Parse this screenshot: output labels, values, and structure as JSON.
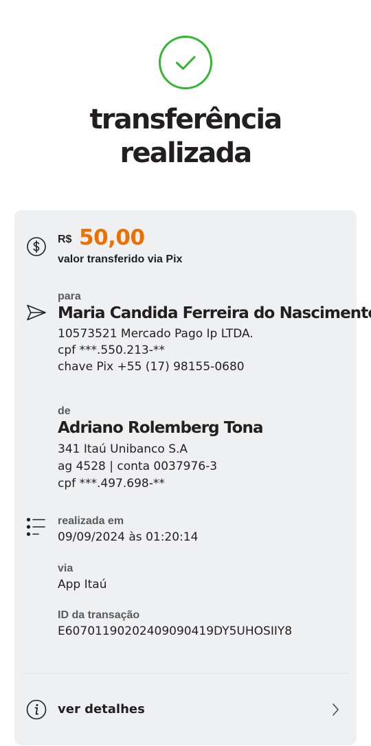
{
  "header": {
    "title_line1": "transferência",
    "title_line2": "realizada",
    "success_color": "#2eb82e"
  },
  "amount": {
    "currency": "R$",
    "value": "50,00",
    "caption": "valor transferido via Pix",
    "color": "#ec7000"
  },
  "recipient": {
    "label": "para",
    "name": "Maria Candida Ferreira do Nascimento",
    "bank": "10573521 Mercado Pago Ip LTDA.",
    "cpf": "cpf ***.550.213-**",
    "pix_key": "chave Pix +55 (17) 98155-0680"
  },
  "sender": {
    "label": "de",
    "name": "Adriano Rolemberg Tona",
    "bank": "341 Itaú Unibanco S.A",
    "account": "ag 4528 | conta 0037976-3",
    "cpf": "cpf ***.497.698-**"
  },
  "details": {
    "date_label": "realizada em",
    "date_value": "09/09/2024 às 01:20:14",
    "via_label": "via",
    "via_value": "App Itaú",
    "id_label": "ID da transação",
    "id_value": "E60701190202409090419DY5UHOSIIY8"
  },
  "footer": {
    "more_details_label": "ver detalhes"
  },
  "icons": [
    "check-circle-icon",
    "dollar-circle-icon",
    "send-icon",
    "list-icon",
    "info-icon",
    "chevron-right-icon"
  ]
}
